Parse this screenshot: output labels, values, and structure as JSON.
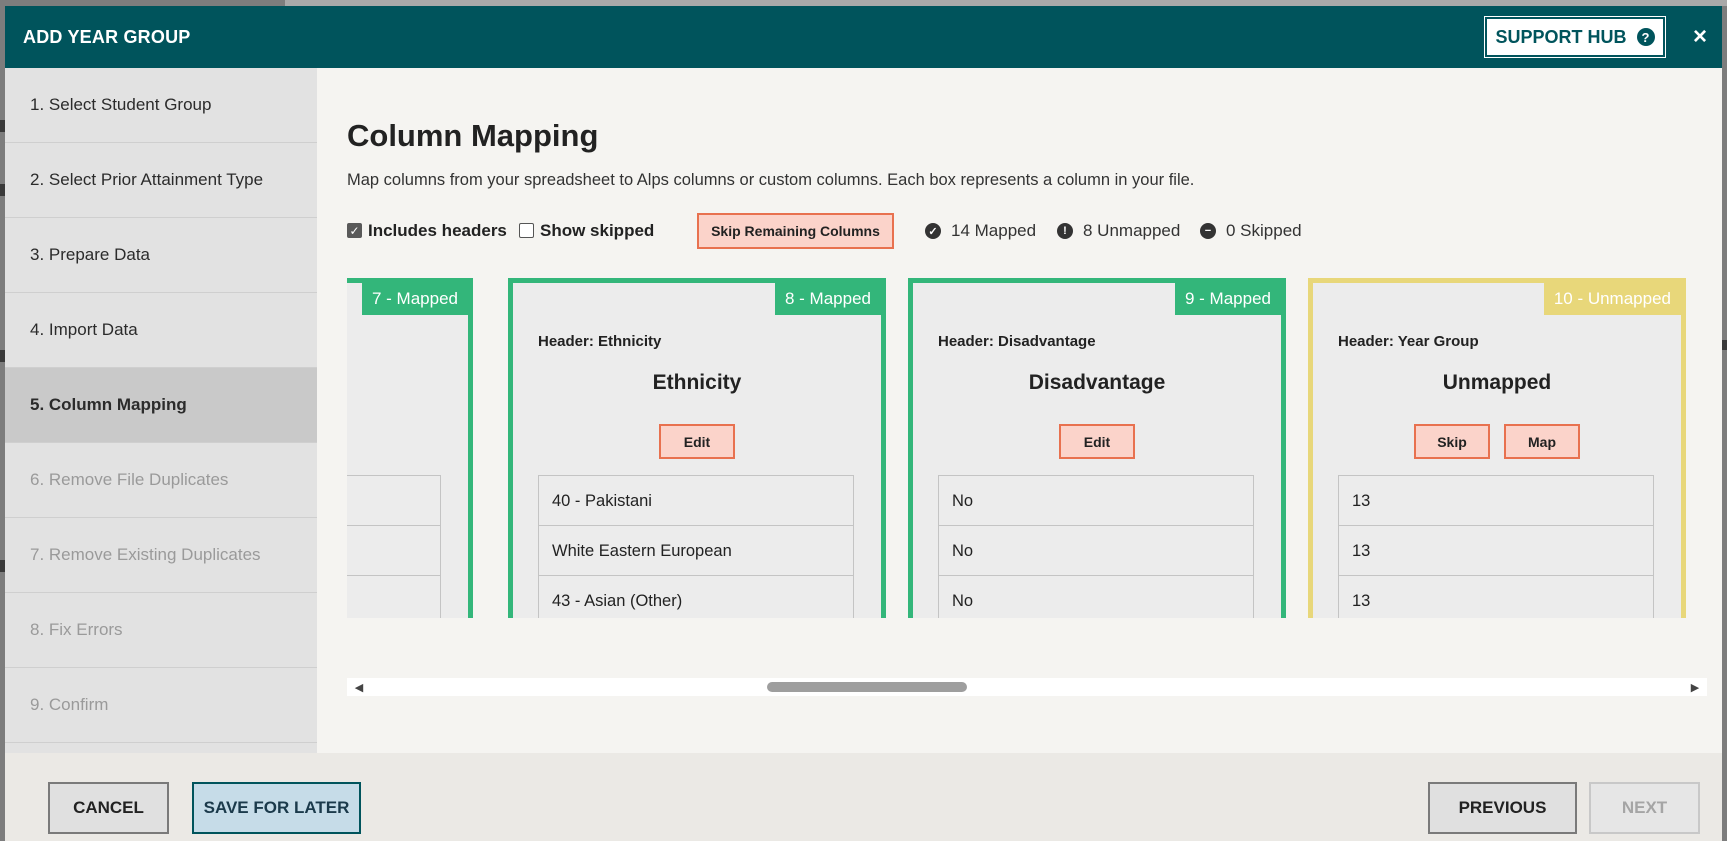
{
  "modal": {
    "title": "ADD YEAR GROUP",
    "support_label": "SUPPORT HUB",
    "help_glyph": "?",
    "close_glyph": "×"
  },
  "sidebar": {
    "steps": [
      {
        "label": "1. Select Student Group",
        "state": "enabled"
      },
      {
        "label": "2. Select Prior Attainment Type",
        "state": "enabled"
      },
      {
        "label": "3. Prepare Data",
        "state": "enabled"
      },
      {
        "label": "4. Import Data",
        "state": "enabled"
      },
      {
        "label": "5. Column Mapping",
        "state": "active"
      },
      {
        "label": "6. Remove File Duplicates",
        "state": "disabled"
      },
      {
        "label": "7. Remove Existing Duplicates",
        "state": "disabled"
      },
      {
        "label": "8. Fix Errors",
        "state": "disabled"
      },
      {
        "label": "9. Confirm",
        "state": "disabled"
      }
    ]
  },
  "main": {
    "title": "Column Mapping",
    "description": "Map columns from your spreadsheet to Alps columns or custom columns. Each box represents a column in your file.",
    "toolbar": {
      "includes_headers_label": "Includes headers",
      "includes_headers_checked": true,
      "show_skipped_label": "Show skipped",
      "show_skipped_checked": false,
      "skip_remaining_label": "Skip Remaining Columns",
      "mapped_text": "14 Mapped",
      "unmapped_text": "8 Unmapped",
      "skipped_text": "0 Skipped",
      "check_glyph": "✓",
      "exclaim_glyph": "!",
      "minus_glyph": "−"
    },
    "cards": [
      {
        "badge": "7 - Mapped",
        "status": "mapped",
        "header": "",
        "name": "",
        "actions": [],
        "values": [
          "",
          "",
          ""
        ]
      },
      {
        "badge": "8 - Mapped",
        "status": "mapped",
        "header": "Header: Ethnicity",
        "name": "Ethnicity",
        "actions": [
          "Edit"
        ],
        "values": [
          "40 - Pakistani",
          "White Eastern European",
          "43 - Asian (Other)"
        ]
      },
      {
        "badge": "9 - Mapped",
        "status": "mapped",
        "header": "Header: Disadvantage",
        "name": "Disadvantage",
        "actions": [
          "Edit"
        ],
        "values": [
          "No",
          "No",
          "No"
        ]
      },
      {
        "badge": "10 - Unmapped",
        "status": "unmapped",
        "header": "Header: Year Group",
        "name": "Unmapped",
        "actions": [
          "Skip",
          "Map"
        ],
        "values": [
          "13",
          "13",
          "13"
        ]
      }
    ],
    "scroll": {
      "left_glyph": "◀",
      "right_glyph": "▶"
    }
  },
  "footer": {
    "cancel_label": "CANCEL",
    "save_label": "SAVE FOR LATER",
    "previous_label": "PREVIOUS",
    "next_label": "NEXT"
  },
  "colors": {
    "header_teal": "#00545c",
    "mapped_green": "#33b67a",
    "unmapped_yellow": "#e8d77a",
    "action_salmon": "#fbd3ca",
    "action_border": "#e8714f"
  },
  "icons": [
    "help-circle-icon",
    "close-icon",
    "check-circle-icon",
    "exclamation-circle-icon",
    "minus-circle-icon",
    "scroll-left-arrow-icon",
    "scroll-right-arrow-icon"
  ]
}
